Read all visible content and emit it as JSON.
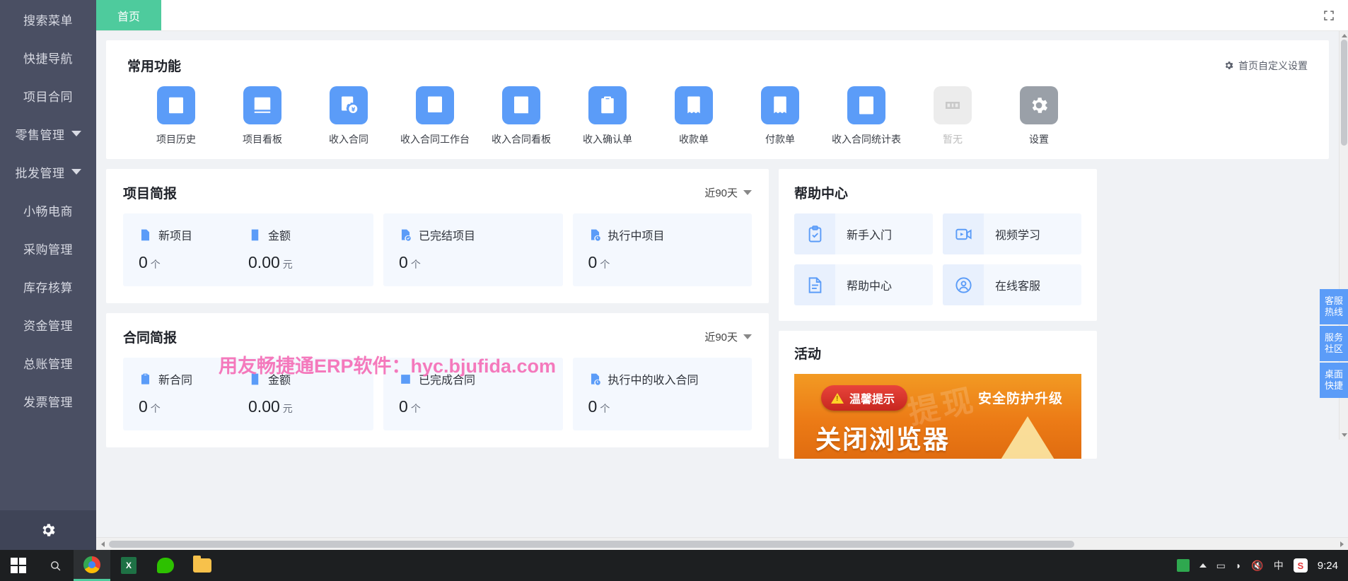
{
  "sidebar": {
    "items": [
      {
        "label": "搜索菜单",
        "has_caret": false
      },
      {
        "label": "快捷导航",
        "has_caret": false
      },
      {
        "label": "项目合同",
        "has_caret": false
      },
      {
        "label": "零售管理",
        "has_caret": true
      },
      {
        "label": "批发管理",
        "has_caret": true
      },
      {
        "label": "小畅电商",
        "has_caret": false
      },
      {
        "label": "采购管理",
        "has_caret": false
      },
      {
        "label": "库存核算",
        "has_caret": false
      },
      {
        "label": "资金管理",
        "has_caret": false
      },
      {
        "label": "总账管理",
        "has_caret": false
      },
      {
        "label": "发票管理",
        "has_caret": false
      }
    ],
    "footer_icon": "gear-icon"
  },
  "topbar": {
    "tabs": [
      {
        "label": "首页",
        "active": true
      }
    ],
    "fullscreen_icon": "fullscreen-icon"
  },
  "quick_functions": {
    "title": "常用功能",
    "customize_label": "首页自定义设置",
    "customize_icon": "gear-icon",
    "items": [
      {
        "label": "项目历史",
        "icon": "list-document-icon",
        "state": "normal"
      },
      {
        "label": "项目看板",
        "icon": "chart-board-icon",
        "state": "normal"
      },
      {
        "label": "收入合同",
        "icon": "invoice-yuan-icon",
        "state": "normal"
      },
      {
        "label": "收入合同工作台",
        "icon": "checklist-doc-icon",
        "state": "normal"
      },
      {
        "label": "收入合同看板",
        "icon": "table-doc-icon",
        "state": "normal"
      },
      {
        "label": "收入确认单",
        "icon": "clipboard-check-icon",
        "state": "normal"
      },
      {
        "label": "收款单",
        "icon": "receive-yuan-icon",
        "state": "normal"
      },
      {
        "label": "付款单",
        "icon": "pay-yuan-icon",
        "state": "normal"
      },
      {
        "label": "收入合同统计表",
        "icon": "stats-report-icon",
        "state": "normal"
      },
      {
        "label": "暂无",
        "icon": "empty-icon",
        "state": "disabled"
      },
      {
        "label": "设置",
        "icon": "gear-icon",
        "state": "grey"
      }
    ]
  },
  "project_brief": {
    "title": "项目简报",
    "range_label": "近90天",
    "stats": [
      {
        "name": "新项目",
        "icon": "doc-blue-icon",
        "value": "0",
        "unit": "个"
      },
      {
        "name": "金额",
        "icon": "yuan-note-icon",
        "value": "0.00",
        "unit": "元"
      },
      {
        "name": "已完结项目",
        "icon": "doc-check-icon",
        "value": "0",
        "unit": "个"
      },
      {
        "name": "执行中项目",
        "icon": "doc-progress-icon",
        "value": "0",
        "unit": "个"
      }
    ]
  },
  "contract_brief": {
    "title": "合同简报",
    "range_label": "近90天",
    "stats": [
      {
        "name": "新合同",
        "icon": "clipboard-icon",
        "value": "0",
        "unit": "个"
      },
      {
        "name": "金额",
        "icon": "yuan-note-icon",
        "value": "0.00",
        "unit": "元"
      },
      {
        "name": "已完成合同",
        "icon": "square-check-icon",
        "value": "0",
        "unit": "个"
      },
      {
        "name": "执行中的收入合同",
        "icon": "doc-progress-icon",
        "value": "0",
        "unit": "个"
      }
    ]
  },
  "help_center": {
    "title": "帮助中心",
    "items": [
      {
        "label": "新手入门",
        "icon": "clipboard-check-icon"
      },
      {
        "label": "视频学习",
        "icon": "video-play-icon"
      },
      {
        "label": "帮助中心",
        "icon": "document-icon"
      },
      {
        "label": "在线客服",
        "icon": "headset-user-icon"
      }
    ]
  },
  "activity": {
    "title": "活动",
    "banner": {
      "badge_label": "温馨提示",
      "badge_icon": "warning-icon",
      "right_text": "安全防护升级",
      "big_text": "关闭浏览器",
      "watermark_text": "提现"
    }
  },
  "watermark": {
    "text": "用友畅捷通ERP软件：hyc.bjufida.com"
  },
  "float_toolbar": {
    "items": [
      {
        "line1": "客服",
        "line2": "热线"
      },
      {
        "line1": "服务",
        "line2": "社区"
      },
      {
        "line1": "桌面",
        "line2": "快捷"
      }
    ]
  },
  "taskbar": {
    "start_icon": "windows-logo-icon",
    "search_icon": "search-icon",
    "apps": [
      {
        "name": "chrome-icon",
        "active": true
      },
      {
        "name": "excel-icon",
        "active": false
      },
      {
        "name": "wechat-icon",
        "active": false
      },
      {
        "name": "folder-icon",
        "active": false
      }
    ],
    "tray": [
      {
        "name": "tray-app-icon"
      },
      {
        "name": "chevron-up-icon"
      },
      {
        "name": "monitor-icon"
      },
      {
        "name": "network-icon"
      },
      {
        "name": "volume-icon"
      },
      {
        "name": "ime-chinese-icon",
        "label": "中"
      },
      {
        "name": "sogou-icon",
        "label": "S"
      }
    ],
    "clock": "9:24"
  },
  "colors": {
    "sidebar_bg": "#4a4f63",
    "accent_green": "#4ecb9d",
    "tile_blue": "#5b9cf8",
    "stat_bg": "#f4f8fe",
    "watermark_pink": "#f573b9",
    "banner_orange": "#ec7b16"
  }
}
